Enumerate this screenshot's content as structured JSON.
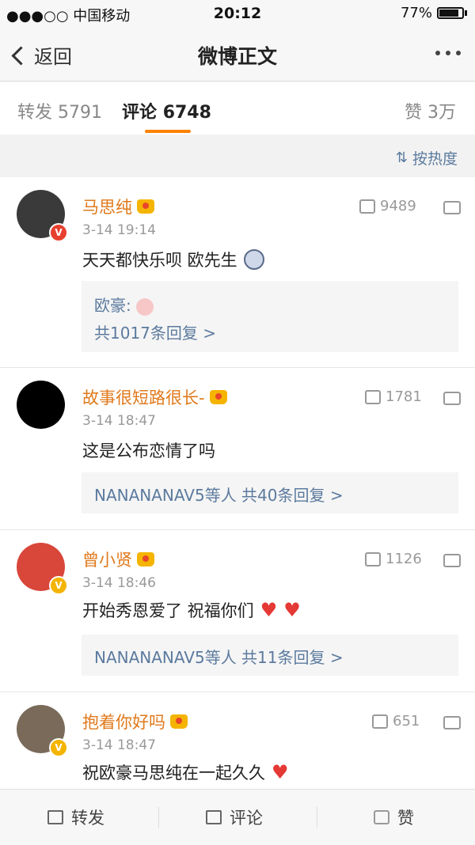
{
  "status": {
    "carrier": "●●●○○ 中国移动",
    "time": "20:12",
    "battery": "77%"
  },
  "nav": {
    "back_label": "返回",
    "title": "微博正文"
  },
  "tabs": {
    "repost_label": "转发",
    "repost_count": "5791",
    "comment_label": "评论",
    "comment_count": "6748",
    "like_label": "赞",
    "like_count": "3万"
  },
  "sort_label": "按热度",
  "comments": [
    {
      "name": "马思纯",
      "time": "3-14 19:14",
      "likes": "9489",
      "text": "天天都快乐呗 欧先生",
      "reply_line1": "欧豪:",
      "reply_line2": "共1017条回复 >"
    },
    {
      "name": "故事很短路很长-",
      "time": "3-14 18:47",
      "likes": "1781",
      "text": "这是公布恋情了吗",
      "reply_line": "NANANANAV5等人  共40条回复 >"
    },
    {
      "name": "曾小贤",
      "time": "3-14 18:46",
      "likes": "1126",
      "text": "开始秀恩爱了  祝福你们",
      "reply_line": "NANANANAV5等人  共11条回复 >"
    },
    {
      "name": "抱着你好吗",
      "time": "3-14 18:47",
      "likes": "651",
      "text": "祝欧豪马思纯在一起久久"
    }
  ],
  "bottom": {
    "repost": "转发",
    "comment": "评论",
    "like": "赞"
  },
  "colors": {
    "accent": "#ff8200",
    "username": "#e0791b",
    "link": "#5b7a9e"
  }
}
